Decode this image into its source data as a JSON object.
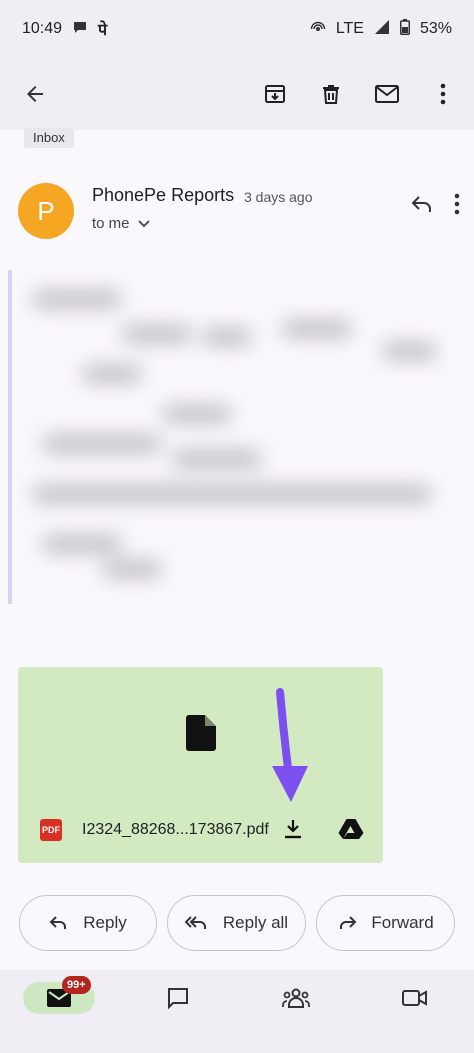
{
  "status_bar": {
    "time": "10:49",
    "pe_glyph": "पे",
    "network": "LTE",
    "battery": "53%"
  },
  "header": {
    "back_icon": "arrow-back-icon",
    "actions": [
      "archive-icon",
      "delete-icon",
      "mark-unread-icon",
      "more-vert-icon"
    ]
  },
  "email": {
    "label": "Inbox",
    "sender": {
      "initial": "P",
      "name": "PhonePe Reports",
      "time": "3 days ago",
      "recipient": "to me",
      "avatar_color": "#f5a623"
    }
  },
  "attachment": {
    "file_type": "PDF",
    "file_name": "I2324_88268...173867.pdf",
    "background": "#d3e9c1"
  },
  "actions": {
    "reply": "Reply",
    "reply_all": "Reply all",
    "forward": "Forward"
  },
  "bottom_nav": {
    "mail_badge": "99+",
    "items": [
      "mail-icon",
      "chat-icon",
      "spaces-icon",
      "meet-icon"
    ]
  },
  "colors": {
    "accent_arrow": "#7b4ff0",
    "badge": "#b3261e"
  }
}
